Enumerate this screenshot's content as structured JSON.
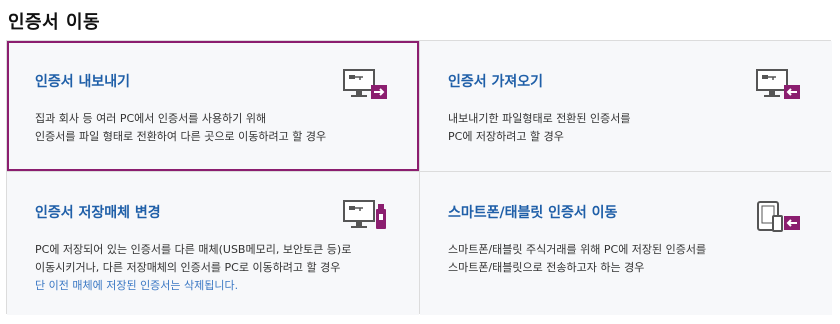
{
  "page": {
    "title": "인증서 이동"
  },
  "cards": [
    {
      "title": "인증서 내보내기",
      "lines": [
        "집과 회사 등 여러 PC에서 인증서를 사용하기 위해",
        "인증서를 파일 형태로 전환하여 다른 곳으로 이동하려고 할 경우"
      ],
      "icon": "pc-export-icon",
      "selected": true
    },
    {
      "title": "인증서 가져오기",
      "lines": [
        "내보내기한 파일형태로 전환된 인증서를",
        "PC에 저장하려고 할 경우"
      ],
      "icon": "pc-import-icon",
      "selected": false
    },
    {
      "title": "인증서 저장매체 변경",
      "lines": [
        "PC에 저장되어 있는 인증서를 다른 매체(USB메모리, 보안토큰 등)로",
        "이동시키거나, 다른 저장매체의 인증서를 PC로 이동하려고 할 경우"
      ],
      "note": "단 이전 매체에 저장된 인증서는 삭제됩니다.",
      "icon": "pc-usb-icon",
      "selected": false
    },
    {
      "title": "스마트폰/태블릿 인증서 이동",
      "lines": [
        "스마트폰/태블릿 주식거래를 위해 PC에 저장된 인증서를",
        "스마트폰/태블릿으로 전송하고자 하는 경우"
      ],
      "icon": "mobile-transfer-icon",
      "selected": false
    }
  ],
  "colors": {
    "accent": "#8b1e6f",
    "title": "#1f5fa8",
    "note": "#3b78c4"
  }
}
